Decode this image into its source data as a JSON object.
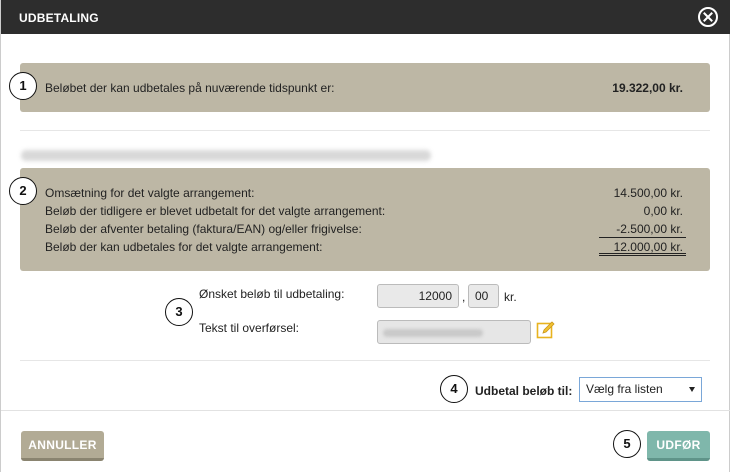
{
  "dialog": {
    "title": "UDBETALING"
  },
  "steps": [
    "1",
    "2",
    "3",
    "4",
    "5"
  ],
  "summary": {
    "label": "Beløbet der kan udbetales på nuværende tidspunkt er:",
    "value": "19.322,00 kr."
  },
  "event_rows": [
    {
      "label": "Omsætning for det valgte arrangement:",
      "value": "14.500,00 kr."
    },
    {
      "label": "Beløb der tidligere er blevet udbetalt for det valgte arrangement:",
      "value": "0,00 kr."
    },
    {
      "label": "Beløb der afventer betaling (faktura/EAN) og/eller frigivelse:",
      "value": "-2.500,00 kr."
    },
    {
      "label": "Beløb der kan udbetales for det valgte arrangement:",
      "value": "12.000,00 kr."
    }
  ],
  "form": {
    "amount_label": "Ønsket beløb til udbetaling:",
    "amount_value": "12000",
    "separator": ",",
    "decimals_value": "00",
    "currency": "kr.",
    "transfer_label": "Tekst til overførsel:"
  },
  "payout": {
    "label": "Udbetal beløb til:",
    "select_value": "Vælg fra listen"
  },
  "buttons": {
    "cancel": "ANNULLER",
    "execute": "UDFØR"
  },
  "colors": {
    "titlebar": "#2d2d2d",
    "panel": "#bdb7a5",
    "cancel_button": "#b2ab95",
    "execute_button": "#7fb7ab"
  }
}
